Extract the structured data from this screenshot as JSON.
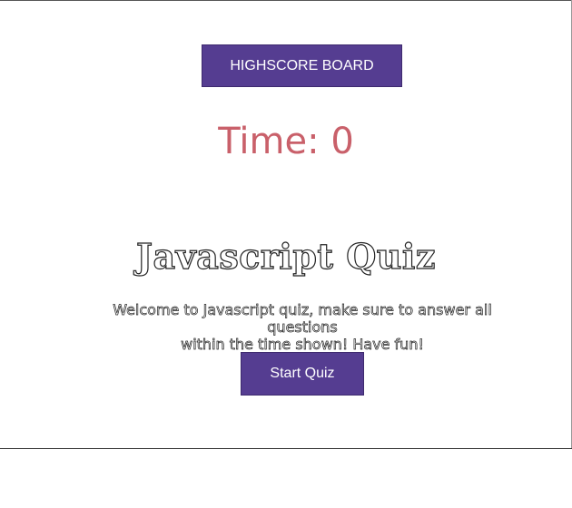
{
  "header": {
    "highscore_label": "HIGHSCORE BOARD"
  },
  "timer": {
    "label": "Time:",
    "value": "0",
    "color": "#c9606a"
  },
  "intro": {
    "title": "Javascript Quiz",
    "welcome_line1": "Welcome to Javascript quiz, make sure to answer all questions",
    "welcome_line2": "within the time shown! Have fun!",
    "start_label": "Start Quiz"
  },
  "colors": {
    "button_bg": "#553d91",
    "button_text": "#ffffff"
  }
}
